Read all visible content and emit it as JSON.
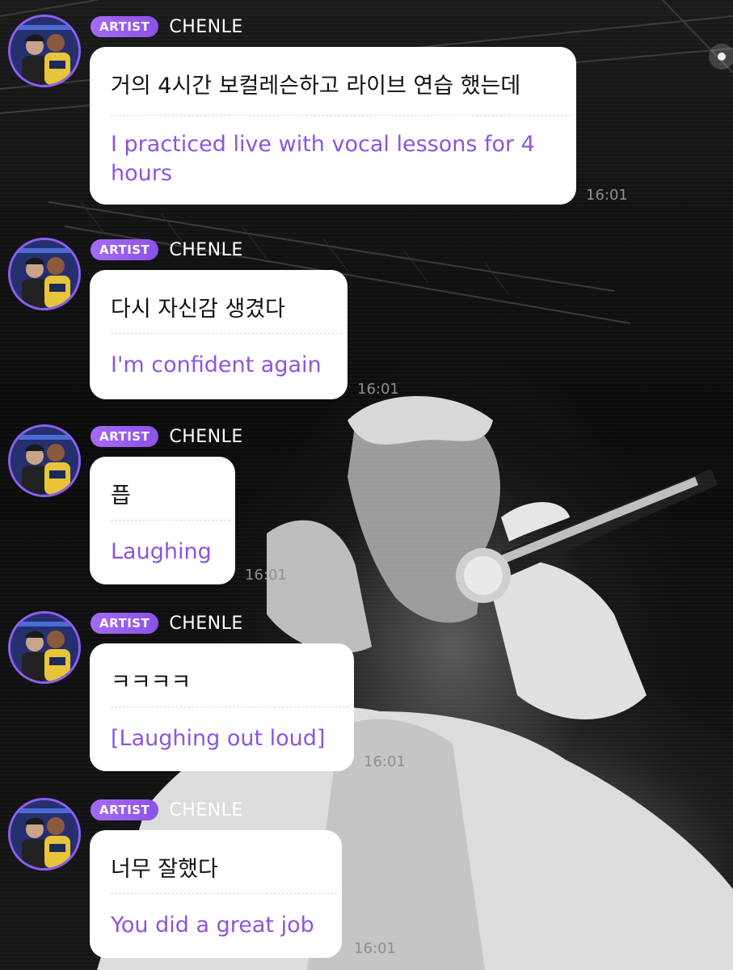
{
  "messages": [
    {
      "badge": "ARTIST",
      "name": "CHENLE",
      "text_ko": "거의 4시간 보컬레슨하고 라이브 연습 했는데",
      "text_en": "I practiced live with vocal lessons for 4 hours",
      "time": "16:01"
    },
    {
      "badge": "ARTIST",
      "name": "CHENLE",
      "text_ko": "다시 자신감 생겼다",
      "text_en": "I'm confident again",
      "time": "16:01"
    },
    {
      "badge": "ARTIST",
      "name": "CHENLE",
      "text_ko": "픕",
      "text_en": "Laughing",
      "time": "16:01"
    },
    {
      "badge": "ARTIST",
      "name": "CHENLE",
      "text_ko": "ㅋㅋㅋㅋ",
      "text_en": "[Laughing out loud]",
      "time": "16:01"
    },
    {
      "badge": "ARTIST",
      "name": "CHENLE",
      "text_ko": "너무 잘했다",
      "text_en": "You did a great job",
      "time": "16:01"
    }
  ],
  "colors": {
    "badge": "#9a5ef0",
    "translation_text": "#8b55e0",
    "avatar_ring": "#8c5ff0"
  },
  "icons": {
    "avatar": "profile-photo-avatar"
  }
}
